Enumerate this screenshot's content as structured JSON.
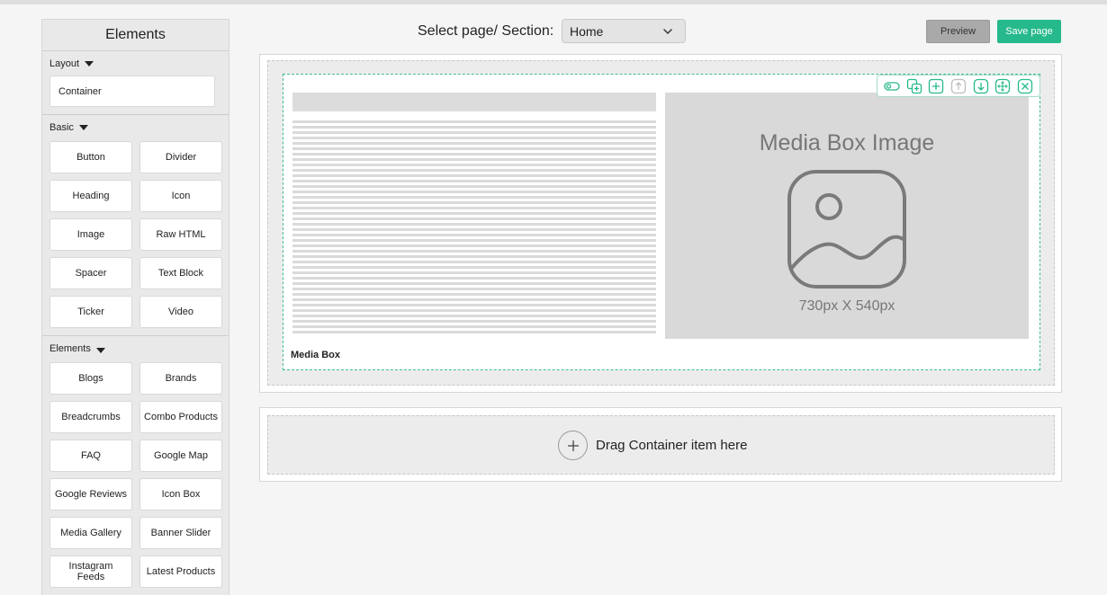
{
  "sidebar": {
    "title": "Elements",
    "layout_group": {
      "label": "Layout",
      "items": [
        "Container"
      ]
    },
    "basic_group": {
      "label": "Basic",
      "items": [
        "Button",
        "Divider",
        "Heading",
        "Icon",
        "Image",
        "Raw HTML",
        "Spacer",
        "Text Block",
        "Ticker",
        "Video"
      ]
    },
    "elements_group": {
      "label": "Elements",
      "items": [
        "Blogs",
        "Brands",
        "Breadcrumbs",
        "Combo Products",
        "FAQ",
        "Google Map",
        "Google Reviews",
        "Icon Box",
        "Media Gallery",
        "Banner Slider",
        "Instagram Feeds",
        "Latest Products"
      ]
    }
  },
  "header": {
    "select_label": "Select page/ Section:",
    "selected_page": "Home",
    "preview_label": "Preview",
    "save_label": "Save page"
  },
  "section1": {
    "mediabox_label": "Media Box",
    "media_title": "Media Box Image",
    "media_dims": "730px X 540px",
    "toolbar_icons": [
      "toggle-icon",
      "duplicate-icon",
      "add-icon",
      "move-up-icon",
      "move-down-icon",
      "drag-move-icon",
      "close-icon"
    ]
  },
  "section2": {
    "drop_text": "Drag Container item here"
  },
  "colors": {
    "accent": "#26b98c",
    "preview": "#a9a9a9",
    "sidebar_bg": "#e9e9e9",
    "placeholder": "#d9d9d9"
  }
}
